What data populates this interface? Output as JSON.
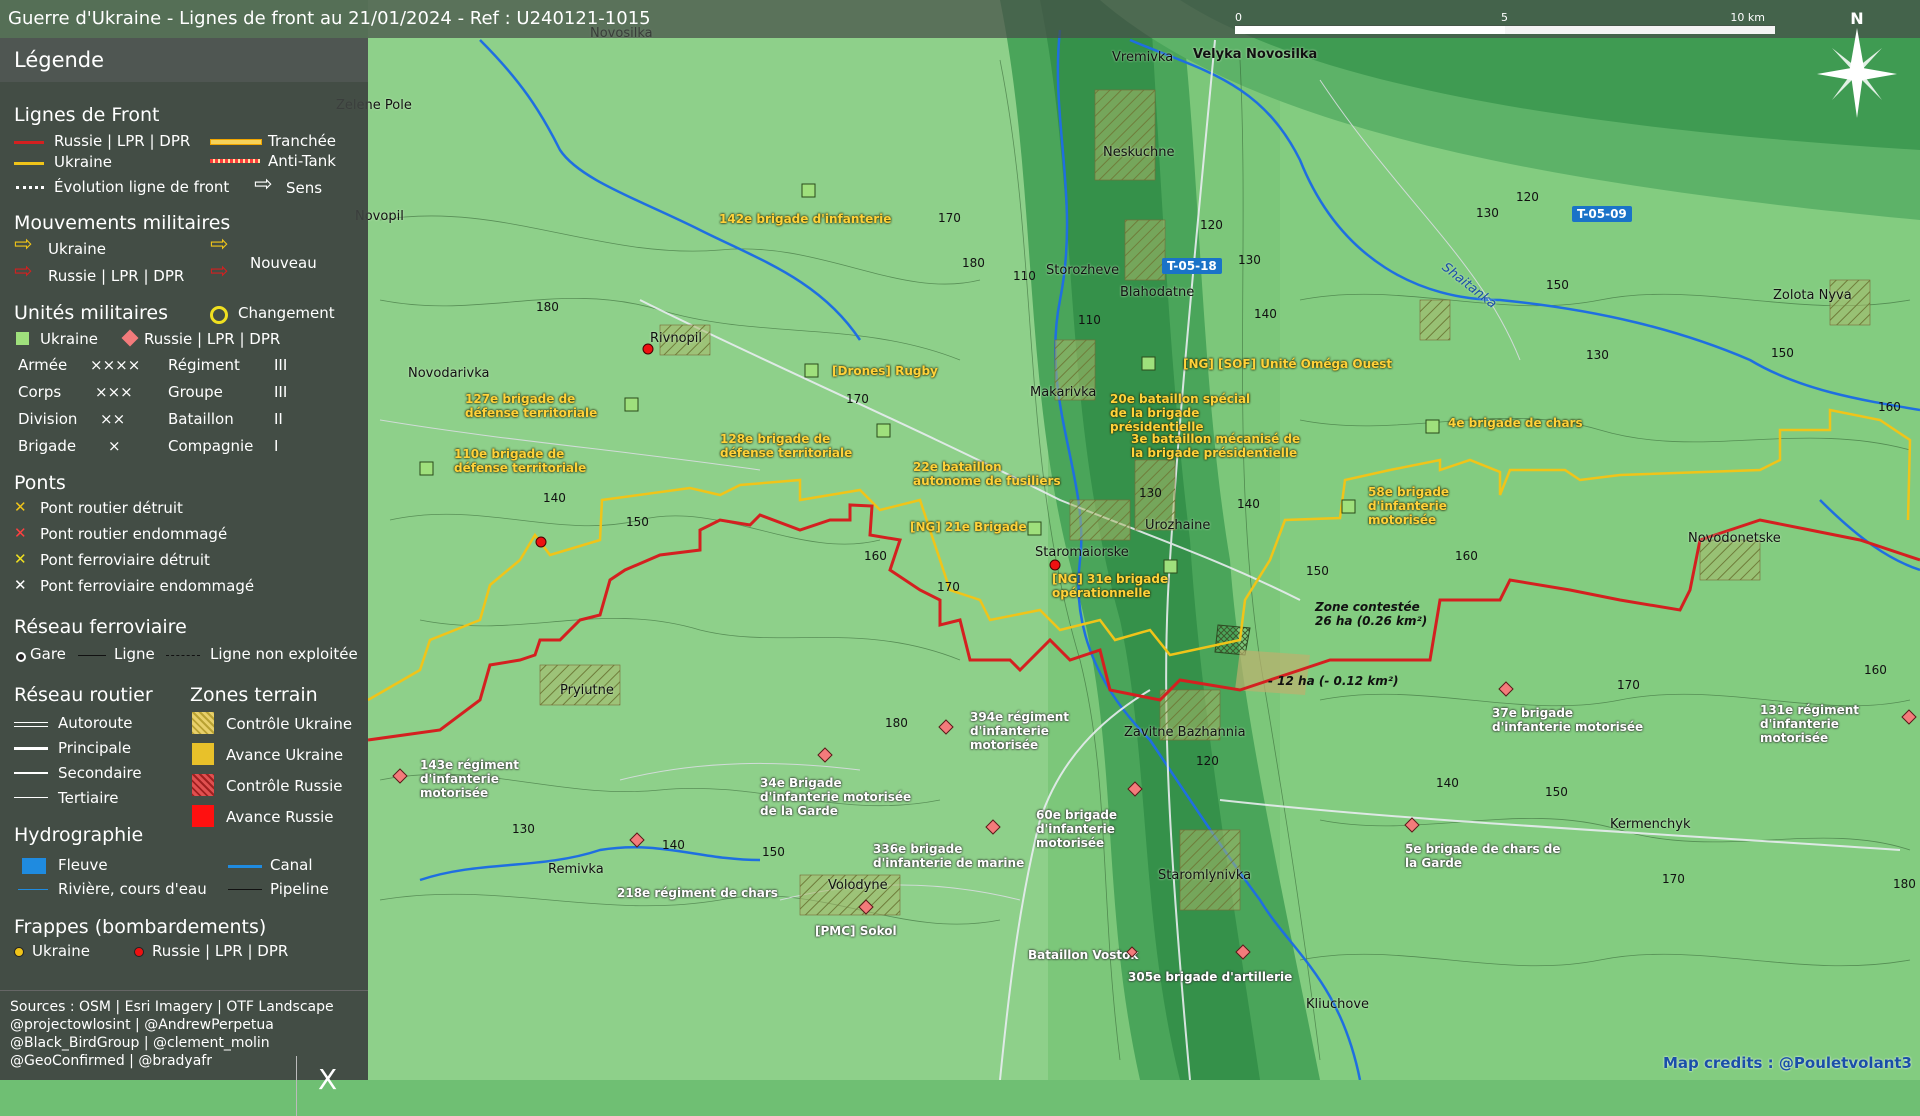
{
  "title": "Guerre d'Ukraine - Lignes de front au 21/01/2024 - Ref : U240121-1015",
  "scale": {
    "labels": [
      "0",
      "5",
      "10 km"
    ]
  },
  "compass": {
    "label": "N"
  },
  "colors": {
    "russia": "#d42020",
    "ukraine": "#f0c419",
    "unit_ukraine": "#9fe07c",
    "unit_russia": "#f37b7b",
    "road_badge": "#1a73c8"
  },
  "legend": {
    "title": "Légende",
    "front": {
      "heading": "Lignes de Front",
      "russia": "Russie | LPR | DPR",
      "ukraine": "Ukraine",
      "trench": "Tranchée",
      "antitank": "Anti-Tank",
      "evolution": "Évolution ligne de front",
      "direction": "Sens"
    },
    "movements": {
      "heading": "Mouvements militaires",
      "ukraine": "Ukraine",
      "russia": "Russie | LPR | DPR",
      "new": "Nouveau"
    },
    "units": {
      "heading": "Unités militaires",
      "change": "Changement",
      "ukraine": "Ukraine",
      "russia": "Russie | LPR | DPR",
      "rows": [
        {
          "a": "Armée",
          "as": "××××",
          "b": "Régiment",
          "bs": "III"
        },
        {
          "a": "Corps",
          "as": "×××",
          "b": "Groupe",
          "bs": "III"
        },
        {
          "a": "Division",
          "as": "××",
          "b": "Bataillon",
          "bs": "II"
        },
        {
          "a": "Brigade",
          "as": "×",
          "b": "Compagnie",
          "bs": "I"
        }
      ]
    },
    "bridges": {
      "heading": "Ponts",
      "items": [
        "Pont routier détruit",
        "Pont routier endommagé",
        "Pont ferroviaire détruit",
        "Pont ferroviaire endommagé"
      ]
    },
    "rail": {
      "heading": "Réseau ferroviaire",
      "station": "Gare",
      "line": "Ligne",
      "unused": "Ligne non exploitée"
    },
    "roads": {
      "heading": "Réseau routier",
      "items": [
        "Autoroute",
        "Principale",
        "Secondaire",
        "Tertiaire"
      ]
    },
    "zones": {
      "heading": "Zones terrain",
      "items": [
        "Contrôle Ukraine",
        "Avance Ukraine",
        "Contrôle Russie",
        "Avance Russie"
      ]
    },
    "hydro": {
      "heading": "Hydrographie",
      "river_big": "Fleuve",
      "canal": "Canal",
      "river": "Rivière, cours d'eau",
      "pipeline": "Pipeline"
    },
    "strikes": {
      "heading": "Frappes (bombardements)",
      "ukraine": "Ukraine",
      "russia": "Russie | LPR | DPR"
    },
    "sources": [
      "Sources : OSM | Esri Imagery | OTF Landscape",
      "@projectowlosint | @AndrewPerpetua",
      "@Black_BirdGroup | @clement_molin",
      "@GeoConfirmed | @bradyafr"
    ],
    "x_logo": "X"
  },
  "places": [
    "Novosilka",
    "Zelene Pole",
    "Novopil",
    "Rivnopil",
    "Novodarivka",
    "Vremivka",
    "Velyka Novosilka",
    "Neskuchne",
    "Storozheve",
    "Blahodatne",
    "Makarivka",
    "Urozhaine",
    "Staromaiorske",
    "Pryiutne",
    "Zavitne Bazhannia",
    "Remivka",
    "Volodyne",
    "Staromlynivka",
    "Kliuchove",
    "Kermenchyk",
    "Novodonetske",
    "Zolota Nyva",
    "Shaitanka"
  ],
  "roads_badges": [
    "T-05-18",
    "T-05-09"
  ],
  "ukraine_units": [
    "142e brigade d'infanterie",
    "[Drones] Rugby",
    "127e brigade de défense territoriale",
    "128e brigade de défense territoriale",
    "110e brigade de défense territoriale",
    "22e bataillon autonome de fusiliers",
    "[NG] 21e Brigade",
    "[NG] 31e brigade opérationnelle",
    "[NG] [SOF] Unité Oméga Ouest",
    "20e bataillon spécial de la brigade présidentielle",
    "3e bataillon mécanisé de la brigade présidentielle",
    "4e brigade de chars",
    "58e brigade d'infanterie motorisée"
  ],
  "russia_units": [
    "394e régiment d'infanterie motorisée",
    "143e régiment d'infanterie motorisée",
    "34e Brigade d'infanterie motorisée de la Garde",
    "218e régiment de chars",
    "336e brigade d'infanterie de marine",
    "[PMC] Sokol",
    "60e brigade d'infanterie motorisée",
    "Bataillon Vostok",
    "305e brigade d'artillerie",
    "37e brigade d'infanterie motorisée",
    "5e brigade de chars de la Garde",
    "131e régiment d'infanterie motorisée"
  ],
  "zones": {
    "contested": "Zone contestée",
    "contested_area": "26 ha (0.26 km²)",
    "loss": "- 12 ha (- 0.12 km²)"
  },
  "altitudes": [
    "170",
    "180",
    "180",
    "170",
    "140",
    "150",
    "160",
    "170",
    "110",
    "110",
    "120",
    "130",
    "120",
    "130",
    "140",
    "150",
    "160",
    "150",
    "130",
    "140",
    "150",
    "160",
    "170",
    "180",
    "120",
    "130",
    "140",
    "150",
    "160",
    "170",
    "180",
    "140",
    "130",
    "150"
  ],
  "credits": "Map credits : @Pouletvolant3"
}
